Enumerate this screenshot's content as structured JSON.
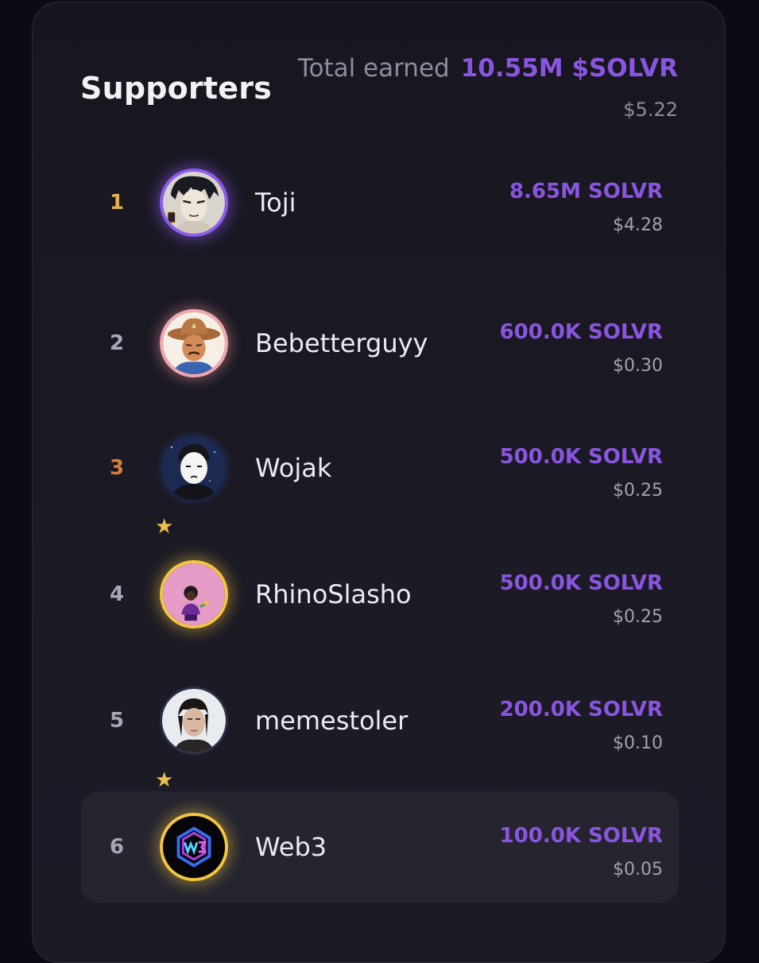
{
  "header": {
    "title": "Supporters",
    "total_label": "Total earned",
    "total_value": "10.55M $SOLVR",
    "total_usd": "$5.22"
  },
  "supporters": [
    {
      "rank": "1",
      "name": "Toji",
      "amount": "8.65M SOLVR",
      "usd": "$4.28",
      "rank_color": "#e8b04a",
      "ring_color": "#8f5cf0"
    },
    {
      "rank": "2",
      "name": "Bebetterguyy",
      "amount": "600.0K SOLVR",
      "usd": "$0.30",
      "rank_color": "#a9a7b5",
      "ring_color": "#f0a8ae"
    },
    {
      "rank": "3",
      "name": "Wojak",
      "amount": "500.0K SOLVR",
      "usd": "$0.25",
      "rank_color": "#d57f3a",
      "ring_color": "#1b2440"
    },
    {
      "rank": "4",
      "name": "RhinoSlasho",
      "amount": "500.0K SOLVR",
      "usd": "$0.25",
      "rank_color": "#a9a7b5",
      "ring_color": "#f2c640",
      "starred": true
    },
    {
      "rank": "5",
      "name": "memestoler",
      "amount": "200.0K SOLVR",
      "usd": "$0.10",
      "rank_color": "#a9a7b5",
      "ring_color": "#2a2f44"
    },
    {
      "rank": "6",
      "name": "Web3",
      "amount": "100.0K SOLVR",
      "usd": "$0.05",
      "rank_color": "#a9a7b5",
      "ring_color": "#f2c640",
      "starred": true,
      "highlighted": true
    }
  ],
  "colors": {
    "accent": "#8a55e0",
    "background": "#1b1a24",
    "star": "#e8c04a"
  }
}
